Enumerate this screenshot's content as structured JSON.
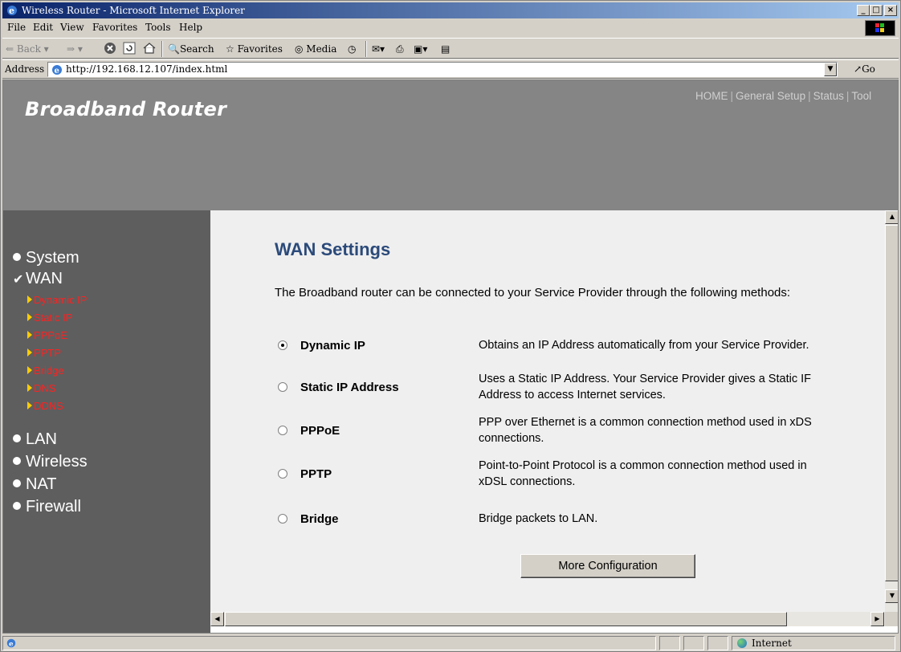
{
  "window": {
    "title": "Wireless Router - Microsoft Internet Explorer",
    "controls": [
      "_",
      "□",
      "×"
    ]
  },
  "menu": {
    "items": [
      "File",
      "Edit",
      "View",
      "Favorites",
      "Tools",
      "Help"
    ]
  },
  "toolbar": {
    "back": "Back",
    "search": "Search",
    "favorites": "Favorites",
    "media": "Media"
  },
  "address": {
    "label": "Address",
    "url": "http://192.168.12.107/index.html",
    "go": "Go"
  },
  "router": {
    "brand": "Broadband Router",
    "topnav": [
      "HOME",
      "General Setup",
      "Status",
      "Tool"
    ]
  },
  "sidebar": {
    "items": [
      {
        "label": "System",
        "icon": "bullet"
      },
      {
        "label": "WAN",
        "icon": "check"
      },
      {
        "label": "LAN",
        "icon": "bullet"
      },
      {
        "label": "Wireless",
        "icon": "bullet"
      },
      {
        "label": "NAT",
        "icon": "bullet"
      },
      {
        "label": "Firewall",
        "icon": "bullet"
      }
    ],
    "wan_sub": [
      "Dynamic IP",
      "Static IP",
      "PPPoE",
      "PPTP",
      "Bridge",
      "DNS",
      "DDNS"
    ]
  },
  "main": {
    "title": "WAN Settings",
    "intro": "The Broadband router can be connected to your Service Provider through the following methods:",
    "options": [
      {
        "label": "Dynamic IP",
        "selected": true,
        "desc": [
          "Obtains an IP Address automatically from your Service Provider."
        ]
      },
      {
        "label": "Static IP Address",
        "selected": false,
        "desc": [
          "Uses a Static IP Address. Your Service Provider gives a Static IF",
          "Address to access Internet services."
        ]
      },
      {
        "label": "PPPoE",
        "selected": false,
        "desc": [
          "PPP over Ethernet is a common connection method used in xDS",
          "connections."
        ]
      },
      {
        "label": "PPTP",
        "selected": false,
        "desc": [
          "Point-to-Point Protocol is a common connection method used in",
          "xDSL connections."
        ]
      },
      {
        "label": "Bridge",
        "selected": false,
        "desc": [
          "Bridge packets to LAN."
        ]
      }
    ],
    "more_button": "More Configuration"
  },
  "status": {
    "zone": "Internet"
  },
  "colors": {
    "banner": "#858585",
    "sidebar": "#5e5e5e",
    "submenu": "#ff2121",
    "heading": "#2b4a7a",
    "content_bg": "#efefef"
  }
}
